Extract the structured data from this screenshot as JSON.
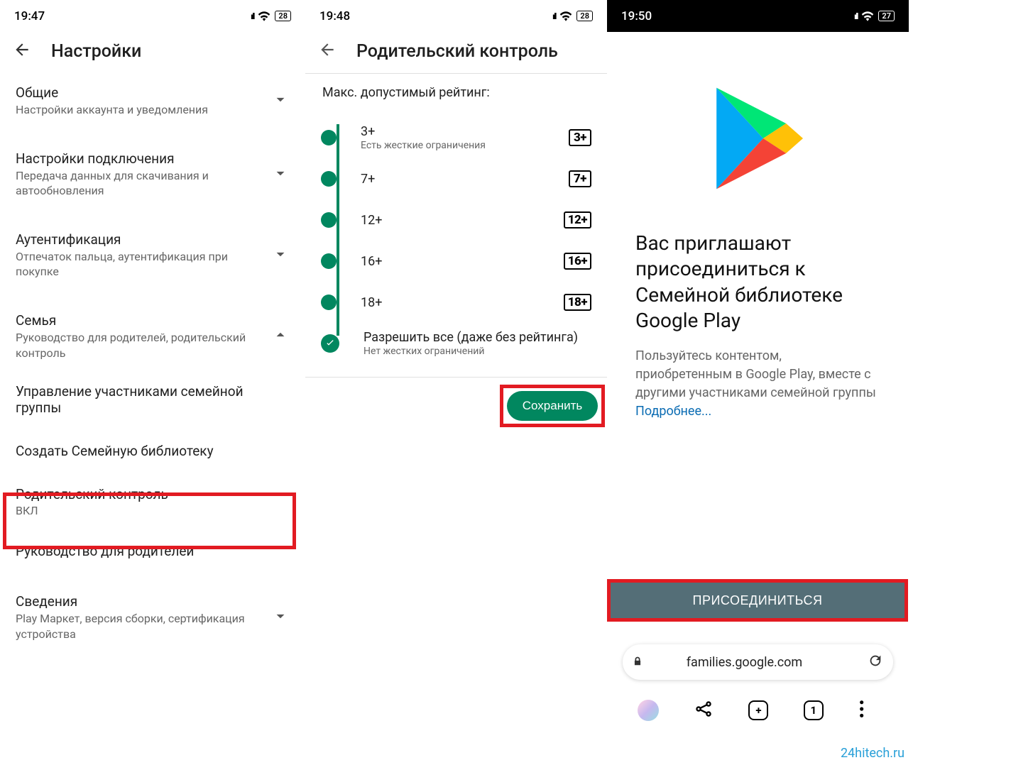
{
  "pane1": {
    "time": "19:47",
    "battery": "28",
    "title": "Настройки",
    "items": [
      {
        "t1": "Общие",
        "t2": "Настройки аккаунта и уведомления",
        "arrow": "down"
      },
      {
        "t1": "Настройки подключения",
        "t2": "Передача данных для скачивания и автообновления",
        "arrow": "down"
      },
      {
        "t1": "Аутентификация",
        "t2": "Отпечаток пальца, аутентификация при покупке",
        "arrow": "down"
      },
      {
        "t1": "Семья",
        "t2": "Руководство для родителей, родительский контроль",
        "arrow": "up"
      }
    ],
    "subitems": [
      {
        "t1": "Управление участниками семейной группы"
      },
      {
        "t1": "Создать Семейную библиотеку"
      },
      {
        "t1": "Родительский контроль",
        "t2": "ВКЛ"
      },
      {
        "t1": "Руководство для родителей"
      }
    ],
    "footer": {
      "t1": "Сведения",
      "t2": "Play Маркет, версия сборки, сертификация устройства",
      "arrow": "down"
    }
  },
  "pane2": {
    "time": "19:48",
    "battery": "28",
    "title": "Родительский контроль",
    "max_label": "Макс. допустимый рейтинг:",
    "ratings": [
      {
        "label": "3+",
        "sub": "Есть жесткие ограничения",
        "badge": "3+"
      },
      {
        "label": "7+",
        "badge": "7+"
      },
      {
        "label": "12+",
        "badge": "12+"
      },
      {
        "label": "16+",
        "badge": "16+"
      },
      {
        "label": "18+",
        "badge": "18+"
      },
      {
        "label": "Разрешить все (даже без рейтинга)",
        "sub": "Нет жестких ограничений",
        "selected": true
      }
    ],
    "save": "Сохранить"
  },
  "pane3": {
    "time": "19:50",
    "battery": "27",
    "heading": "Вас приглашают присоединиться к Семейной библиотеке Google Play",
    "body": "Пользуйтесь контентом, приобретенным в Google Play, вместе с другими участниками семейной группы ",
    "more": "Подробнее...",
    "join": "ПРИСОЕДИНИТЬСЯ",
    "url": "families.google.com",
    "tab_count": "1",
    "watermark": "24hitech.ru"
  }
}
